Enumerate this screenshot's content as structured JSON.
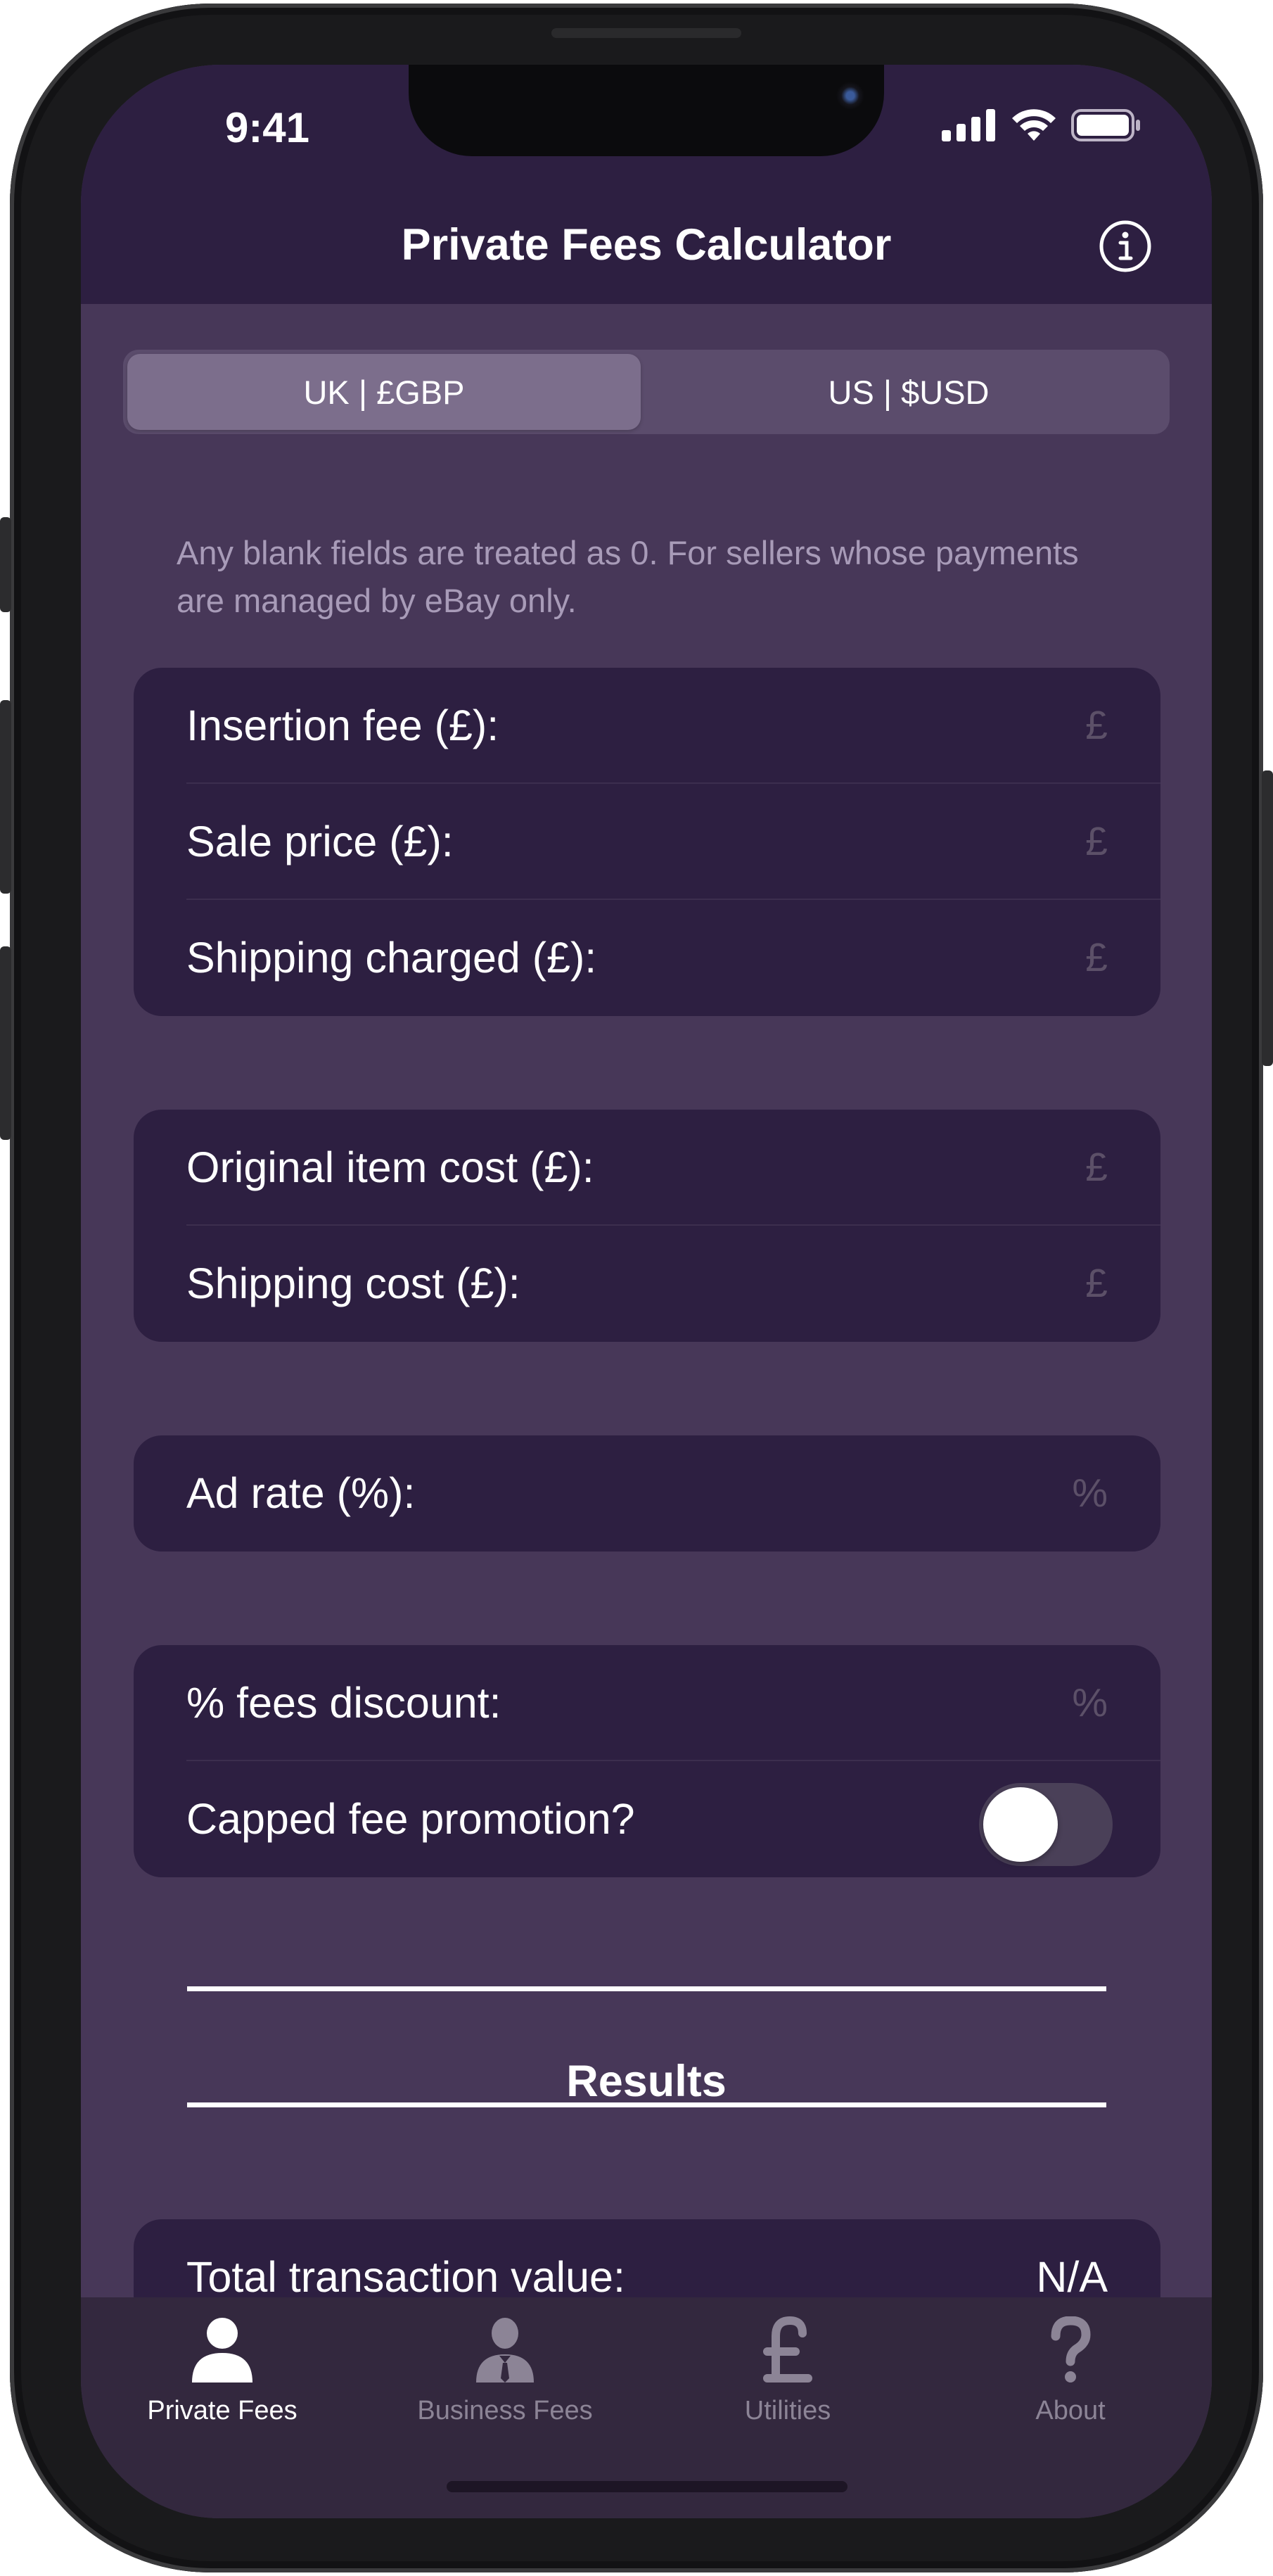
{
  "status_bar": {
    "time": "9:41",
    "icons": [
      "signal-icon",
      "wifi-icon",
      "battery-icon"
    ]
  },
  "nav": {
    "title": "Private Fees Calculator",
    "info_icon": "info-icon"
  },
  "currency": {
    "options": [
      "UK | £GBP",
      "US | $USD"
    ],
    "selected": "UK | £GBP"
  },
  "note": "Any blank fields are treated as 0. For sellers whose payments are managed by eBay only.",
  "sale_fields": [
    {
      "label": "Insertion fee (£):",
      "placeholder": "£"
    },
    {
      "label": "Sale price (£):",
      "placeholder": "£"
    },
    {
      "label": "Shipping charged (£):",
      "placeholder": "£"
    }
  ],
  "cost_fields": [
    {
      "label": "Original item cost (£):",
      "placeholder": "£"
    },
    {
      "label": "Shipping cost (£):",
      "placeholder": "£"
    }
  ],
  "ad_fields": [
    {
      "label": "Ad rate (%):",
      "placeholder": "%"
    }
  ],
  "discount_field": {
    "label": "% fees discount:",
    "placeholder": "%"
  },
  "capped_promo": {
    "label": "Capped fee promotion?",
    "enabled": false
  },
  "results": {
    "title": "Results",
    "rows": [
      {
        "label": "Total transaction value:",
        "value": "N/A"
      }
    ]
  },
  "tabs": [
    {
      "label": "Private Fees",
      "icon": "person-icon",
      "active": true
    },
    {
      "label": "Business Fees",
      "icon": "business-person-icon",
      "active": false
    },
    {
      "label": "Utilities",
      "icon": "pound-icon",
      "active": false
    },
    {
      "label": "About",
      "icon": "question-icon",
      "active": false
    }
  ],
  "colors": {
    "header_bg": "#2d1f41",
    "content_bg": "#473758",
    "active_tab": "#ffffff",
    "inactive_tab": "#8c8496"
  }
}
